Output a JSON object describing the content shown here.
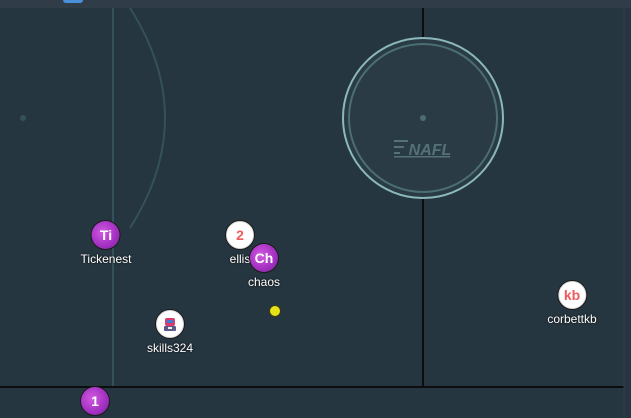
{
  "pitch": {
    "logo_text": "NAFL",
    "colors": {
      "background": "#263640",
      "markings": "#34505a",
      "center_circle": "#8bb8ba",
      "boundary": "#0d0d0d",
      "team_purple": "#a632c4",
      "ball": "#e6e21a"
    }
  },
  "players": [
    {
      "token": "Ti",
      "name": "Tickenest",
      "style": "purple"
    },
    {
      "token": "2",
      "name": "ellis",
      "style": "white"
    },
    {
      "token": "Ch",
      "name": "chaos",
      "style": "purple"
    },
    {
      "token": "",
      "name": "skills324",
      "style": "avatar",
      "icon": "robot-avatar-icon"
    },
    {
      "token": "kb",
      "name": "corbettkb",
      "style": "white"
    },
    {
      "token": "1",
      "name": "",
      "style": "purple"
    }
  ]
}
